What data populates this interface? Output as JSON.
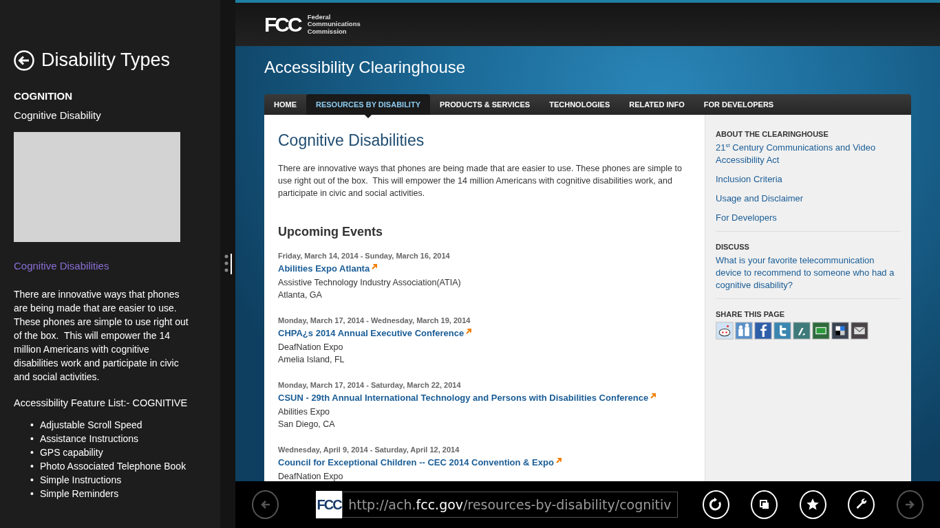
{
  "app_panel": {
    "title": "Disability Types",
    "category": "COGNITION",
    "subtitle": "Cognitive Disability",
    "link": "Cognitive Disabilities",
    "description": "There are innovative ways that phones are being made that are easier to use. These phones are simple to use right out of the box.  This will empower the 14 million Americans with cognitive disabilities work and participate in civic and social activities.",
    "feature_heading": "Accessibility Feature List:- COGNITIVE",
    "bullet": "•",
    "features": [
      "Adjustable Scroll Speed",
      "Assistance Instructions",
      "GPS capability",
      "Photo Associated Telephone Book",
      "Simple Instructions",
      "Simple Reminders"
    ]
  },
  "website": {
    "logo": "FCC",
    "agency": [
      "Federal",
      "Communications",
      "Commission"
    ],
    "site_title": "Accessibility Clearinghouse",
    "nav": [
      {
        "label": "HOME",
        "selected": false
      },
      {
        "label": "RESOURCES BY DISABILITY",
        "selected": true
      },
      {
        "label": "PRODUCTS & SERVICES",
        "selected": false
      },
      {
        "label": "TECHNOLOGIES",
        "selected": false
      },
      {
        "label": "RELATED INFO",
        "selected": false
      },
      {
        "label": "FOR DEVELOPERS",
        "selected": false
      }
    ],
    "heading": "Cognitive Disabilities",
    "intro": "There are innovative ways that phones are being made that are easier to use. These phones are simple to use right out of the box.  This will empower the 14 million Americans with cognitive disabilities work, and participate in civic and social activities.",
    "events_heading": "Upcoming Events",
    "events": [
      {
        "date": "Friday, March 14, 2014 - Sunday, March 16, 2014",
        "title": "Abilities Expo Atlanta",
        "organizer": "Assistive Technology Industry Association(ATIA)",
        "location": "Atlanta, GA"
      },
      {
        "date": "Monday, March 17, 2014 - Wednesday, March 19, 2014",
        "title": "CHPA¿s 2014 Annual Executive Conference",
        "organizer": "DeafNation Expo",
        "location": "Amelia Island, FL"
      },
      {
        "date": "Monday, March 17, 2014 - Saturday, March 22, 2014",
        "title": "CSUN - 29th Annual International Technology and Persons with Disabilities Conference",
        "organizer": "Abilities Expo",
        "location": "San Diego, CA"
      },
      {
        "date": "Wednesday, April 9, 2014 - Saturday, April 12, 2014",
        "title": "Council for Exceptional Children -- CEC 2014 Convention & Expo",
        "organizer": "DeafNation Expo"
      }
    ],
    "sidebar": {
      "about_heading": "ABOUT THE CLEARINGHOUSE",
      "about_links": [
        "21$^{st}$ Century Communications and Video Accessibility Act",
        "Inclusion Criteria",
        "Usage and Disclaimer",
        "For Developers"
      ],
      "discuss_heading": "DISCUSS",
      "discuss_link": "What is your favorite telecommunication device to recommend to someone who had a cognitive disability?",
      "share_heading": "SHARE THIS PAGE"
    }
  },
  "browser_bar": {
    "site_logo": "FCC",
    "url": {
      "before": "http://ach.",
      "domain": "fcc.gov",
      "after": "/resources-by-disability/cognitiv"
    },
    "buttons": [
      {
        "kind": "back",
        "disabled": true
      },
      {
        "kind": "url"
      },
      {
        "kind": "refresh",
        "disabled": false
      },
      {
        "kind": "tabs",
        "disabled": false
      },
      {
        "kind": "pin",
        "disabled": false
      },
      {
        "kind": "tools",
        "disabled": false
      },
      {
        "kind": "forward",
        "disabled": true
      }
    ]
  }
}
